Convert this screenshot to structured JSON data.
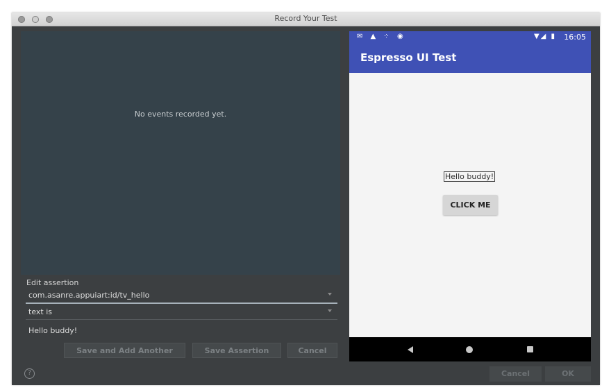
{
  "window": {
    "title": "Record Your Test"
  },
  "events": {
    "empty_text": "No events recorded yet."
  },
  "assertion": {
    "section_label": "Edit assertion",
    "element_id": "com.asanre.appuiart:id/tv_hello",
    "condition": "text is",
    "value": "Hello buddy!"
  },
  "buttons": {
    "save_and_add": "Save and Add Another",
    "save_assertion": "Save Assertion",
    "cancel_inner": "Cancel",
    "cancel": "Cancel",
    "ok": "OK"
  },
  "help": {
    "glyph": "?"
  },
  "device": {
    "status_icons": "✉ ▲ ⁘ ◉",
    "signal_icons": "▼◢ ▮",
    "time": "16:05",
    "app_title": "Espresso UI Test",
    "hello_text": "Hello buddy!",
    "button_label": "CLICK ME"
  }
}
